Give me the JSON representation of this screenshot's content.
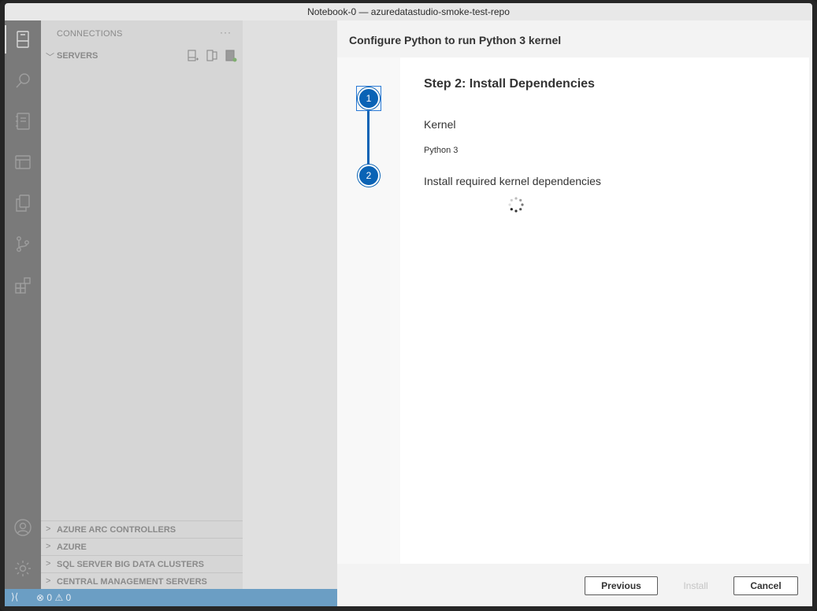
{
  "window": {
    "title": "Notebook-0 — azuredatastudio-smoke-test-repo"
  },
  "activity_bar": {
    "items": [
      {
        "icon": "connections-icon",
        "active": true
      },
      {
        "icon": "search-icon",
        "active": false
      },
      {
        "icon": "notebook-icon",
        "active": false
      },
      {
        "icon": "tasks-icon",
        "active": false
      },
      {
        "icon": "explorer-icon",
        "active": false
      },
      {
        "icon": "source-control-icon",
        "active": false
      },
      {
        "icon": "extensions-icon",
        "active": false
      }
    ],
    "bottom_items": [
      {
        "icon": "account-icon"
      },
      {
        "icon": "manage-gear-icon"
      }
    ]
  },
  "sidebar": {
    "header": "CONNECTIONS",
    "more": "···",
    "servers_label": "SERVERS",
    "sections": [
      "AZURE ARC CONTROLLERS",
      "AZURE",
      "SQL SERVER BIG DATA CLUSTERS",
      "CENTRAL MANAGEMENT SERVERS"
    ]
  },
  "status_bar": {
    "errors": "0",
    "warnings": "0"
  },
  "dialog": {
    "title": "Configure Python to run Python 3 kernel",
    "steps": [
      "1",
      "2"
    ],
    "current_step_title": "Step 2: Install Dependencies",
    "kernel_label": "Kernel",
    "kernel_value": "Python 3",
    "dependencies_label": "Install required kernel dependencies",
    "buttons": {
      "previous": "Previous",
      "install": "Install",
      "cancel": "Cancel"
    }
  },
  "colors": {
    "accent": "#0a63b5",
    "status_bar": "#6b9ec4"
  }
}
